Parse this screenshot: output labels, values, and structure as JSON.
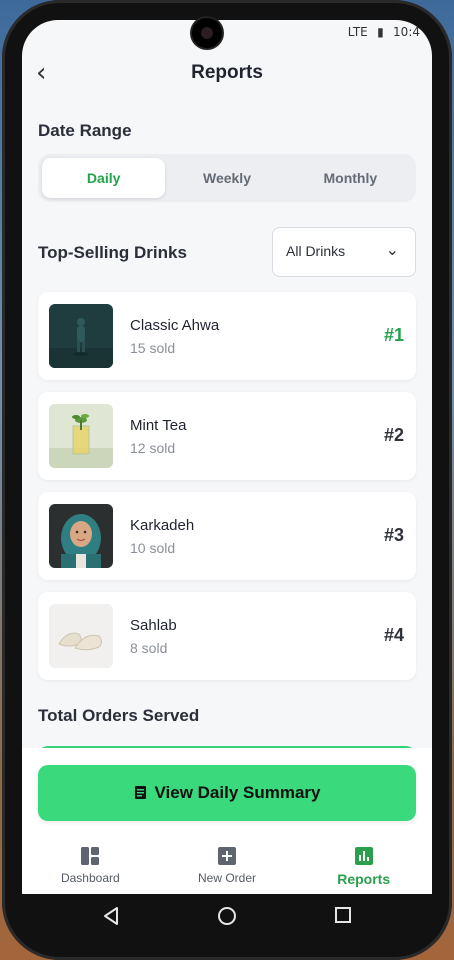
{
  "status": {
    "network": "LTE",
    "time": "10:4"
  },
  "header": {
    "title": "Reports",
    "back_label": "‹"
  },
  "date_range": {
    "title": "Date Range",
    "options": [
      "Daily",
      "Weekly",
      "Monthly"
    ],
    "selected": "Daily"
  },
  "top_selling": {
    "title": "Top-Selling Drinks",
    "filter": {
      "value": "All Drinks",
      "chevron": "⌄"
    },
    "items": [
      {
        "name": "Classic Ahwa",
        "sold": "15 sold",
        "rank": "#1",
        "image": "figurine-photo"
      },
      {
        "name": "Mint Tea",
        "sold": "12 sold",
        "rank": "#2",
        "image": "mint-tea-glass-photo"
      },
      {
        "name": "Karkadeh",
        "sold": "10 sold",
        "rank": "#3",
        "image": "person-portrait-photo"
      },
      {
        "name": "Sahlab",
        "sold": "8 sold",
        "rank": "#4",
        "image": "shoes-photo"
      }
    ]
  },
  "total_orders": {
    "title": "Total Orders Served"
  },
  "cta": {
    "label": "View Daily Summary",
    "icon": "document-icon"
  },
  "bottom_nav": {
    "items": [
      {
        "label": "Dashboard",
        "icon": "dashboard-icon"
      },
      {
        "label": "New Order",
        "icon": "plus-square-icon"
      },
      {
        "label": "Reports",
        "icon": "bar-chart-icon"
      }
    ],
    "active": "Reports"
  },
  "colors": {
    "accent": "#20a34a",
    "cta": "#3ad97c",
    "background": "#f6f7f9"
  }
}
